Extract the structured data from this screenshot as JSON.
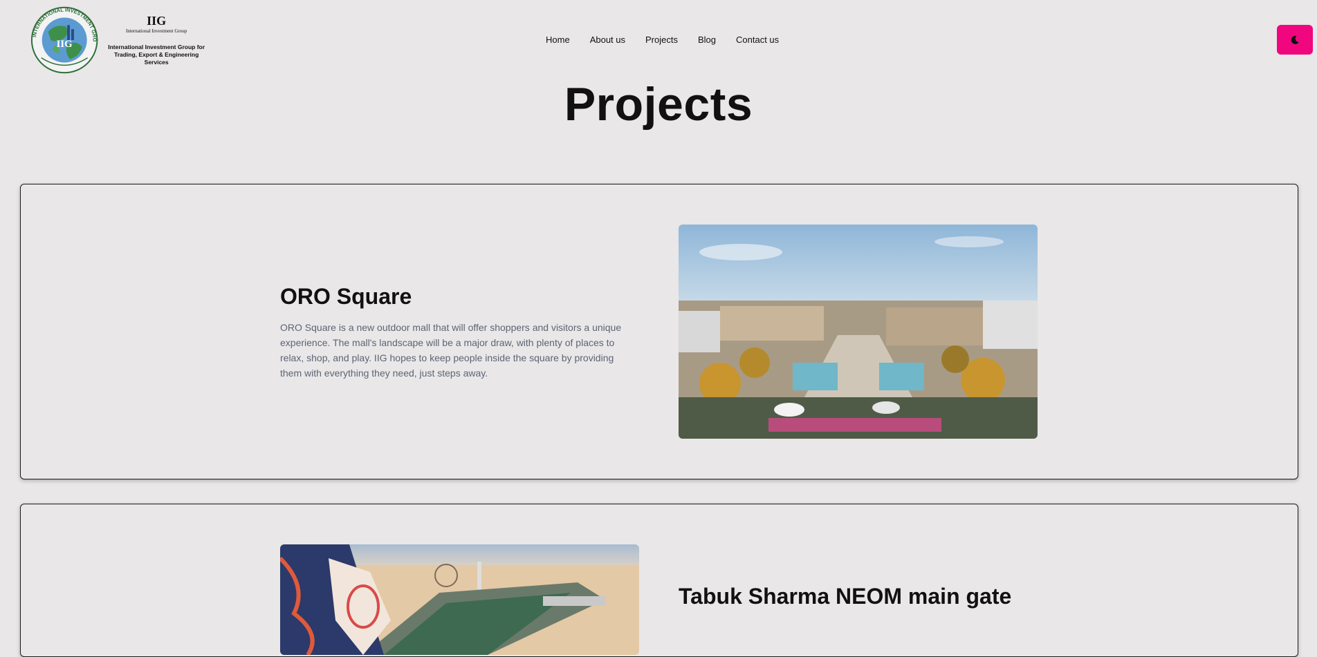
{
  "header": {
    "logo": {
      "seal_ring_text": "INTERNATIONAL INVESTMENT GROUP",
      "seal_center": "IIG",
      "abbr": "IIG",
      "sub": "International Investment Group",
      "full_line1": "International Investment Group for",
      "full_line2": "Trading, Export & Engineering Services"
    },
    "nav": [
      {
        "label": "Home"
      },
      {
        "label": "About us"
      },
      {
        "label": "Projects"
      },
      {
        "label": "Blog"
      },
      {
        "label": "Contact us"
      }
    ],
    "theme_toggle_icon": "moon-icon",
    "accent_color": "#f0077f"
  },
  "page": {
    "title": "Projects"
  },
  "projects": [
    {
      "title": "ORO Square",
      "description": "ORO Square is a new outdoor mall that will offer shoppers and visitors a unique experience. The mall's landscape will be a major draw, with plenty of places to relax, shop, and play. IIG hopes to keep people inside the square by providing them with everything they need, just steps away."
    },
    {
      "title": "Tabuk Sharma NEOM main gate"
    }
  ]
}
